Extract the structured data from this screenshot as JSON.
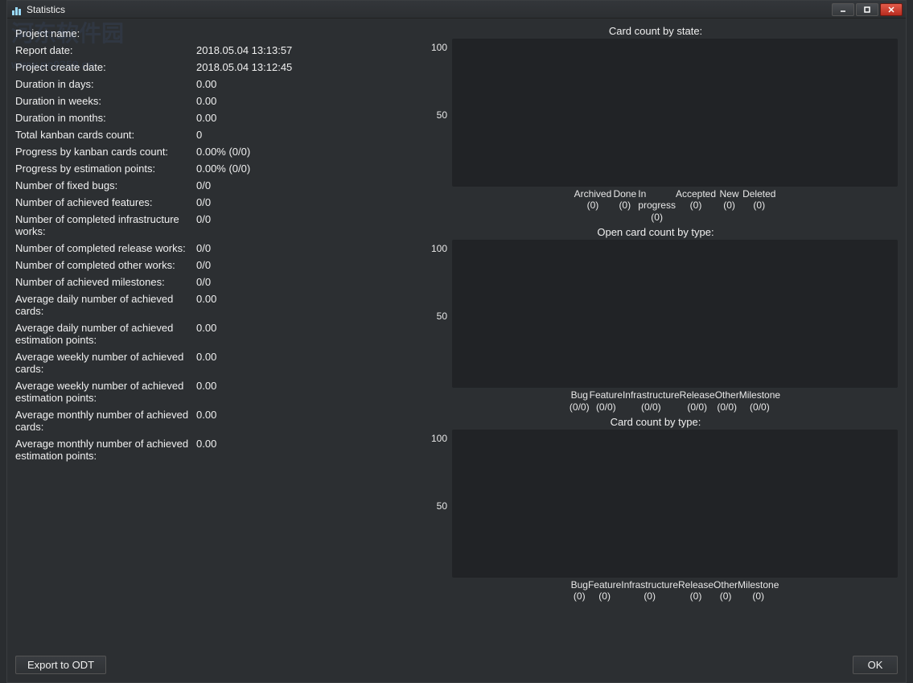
{
  "window": {
    "title": "Statistics"
  },
  "stats": [
    {
      "label": "Project name:",
      "value": ""
    },
    {
      "label": "Report date:",
      "value": "2018.05.04 13:13:57"
    },
    {
      "label": "Project create date:",
      "value": "2018.05.04 13:12:45"
    },
    {
      "label": "Duration in days:",
      "value": "0.00"
    },
    {
      "label": "Duration in weeks:",
      "value": "0.00"
    },
    {
      "label": "Duration in months:",
      "value": "0.00"
    },
    {
      "label": "Total kanban cards count:",
      "value": "0"
    },
    {
      "label": "Progress by kanban cards count:",
      "value": "0.00% (0/0)"
    },
    {
      "label": "Progress by estimation points:",
      "value": "0.00% (0/0)"
    },
    {
      "label": "Number of fixed bugs:",
      "value": "0/0"
    },
    {
      "label": "Number of achieved features:",
      "value": "0/0"
    },
    {
      "label": "Number of completed infrastructure works:",
      "value": "0/0"
    },
    {
      "label": "Number of completed release works:",
      "value": "0/0"
    },
    {
      "label": "Number of completed other works:",
      "value": "0/0"
    },
    {
      "label": "Number of achieved milestones:",
      "value": "0/0"
    },
    {
      "label": "Average daily number of achieved cards:",
      "value": "0.00"
    },
    {
      "label": "Average daily number of achieved estimation points:",
      "value": "0.00"
    },
    {
      "label": "Average weekly number of achieved cards:",
      "value": "0.00"
    },
    {
      "label": "Average weekly number of achieved estimation points:",
      "value": "0.00"
    },
    {
      "label": "Average monthly number of achieved cards:",
      "value": "0.00"
    },
    {
      "label": "Average monthly number of achieved estimation points:",
      "value": "0.00"
    }
  ],
  "charts": [
    {
      "title": "Card count by state:",
      "yticks": [
        "100",
        "50"
      ],
      "categories": [
        {
          "name": "Archived",
          "count": "(0)"
        },
        {
          "name": "Done",
          "count": "(0)"
        },
        {
          "name": "In progress",
          "count": "(0)"
        },
        {
          "name": "Accepted",
          "count": "(0)"
        },
        {
          "name": "New",
          "count": "(0)"
        },
        {
          "name": "Deleted",
          "count": "(0)"
        }
      ]
    },
    {
      "title": "Open card count by type:",
      "yticks": [
        "100",
        "50"
      ],
      "categories": [
        {
          "name": "Bug",
          "count": "(0/0)"
        },
        {
          "name": "Feature",
          "count": "(0/0)"
        },
        {
          "name": "Infrastructure",
          "count": "(0/0)"
        },
        {
          "name": "Release",
          "count": "(0/0)"
        },
        {
          "name": "Other",
          "count": "(0/0)"
        },
        {
          "name": "Milestone",
          "count": "(0/0)"
        }
      ]
    },
    {
      "title": "Card count by type:",
      "yticks": [
        "100",
        "50"
      ],
      "categories": [
        {
          "name": "Bug",
          "count": "(0)"
        },
        {
          "name": "Feature",
          "count": "(0)"
        },
        {
          "name": "Infrastructure",
          "count": "(0)"
        },
        {
          "name": "Release",
          "count": "(0)"
        },
        {
          "name": "Other",
          "count": "(0)"
        },
        {
          "name": "Milestone",
          "count": "(0)"
        }
      ]
    }
  ],
  "buttons": {
    "export": "Export to ODT",
    "ok": "OK"
  },
  "chart_data": [
    {
      "type": "bar",
      "title": "Card count by state:",
      "categories": [
        "Archived",
        "Done",
        "In progress",
        "Accepted",
        "New",
        "Deleted"
      ],
      "values": [
        0,
        0,
        0,
        0,
        0,
        0
      ],
      "ylim": [
        0,
        100
      ],
      "xlabel": "",
      "ylabel": ""
    },
    {
      "type": "bar",
      "title": "Open card count by type:",
      "categories": [
        "Bug",
        "Feature",
        "Infrastructure",
        "Release",
        "Other",
        "Milestone"
      ],
      "values": [
        0,
        0,
        0,
        0,
        0,
        0
      ],
      "ylim": [
        0,
        100
      ],
      "xlabel": "",
      "ylabel": ""
    },
    {
      "type": "bar",
      "title": "Card count by type:",
      "categories": [
        "Bug",
        "Feature",
        "Infrastructure",
        "Release",
        "Other",
        "Milestone"
      ],
      "values": [
        0,
        0,
        0,
        0,
        0,
        0
      ],
      "ylim": [
        0,
        100
      ],
      "xlabel": "",
      "ylabel": ""
    }
  ]
}
